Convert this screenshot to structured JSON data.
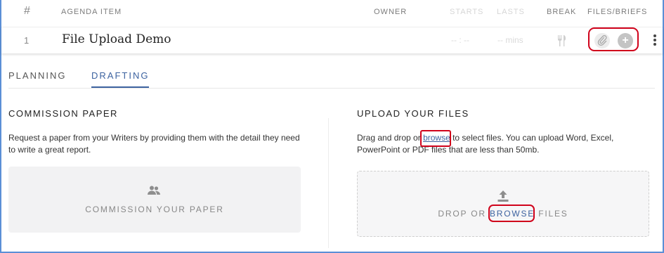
{
  "header": {
    "num": "#",
    "agenda_item": "AGENDA ITEM",
    "owner": "OWNER",
    "starts": "STARTS",
    "lasts": "LASTS",
    "break": "BREAK",
    "files_briefs": "FILES/BRIEFS"
  },
  "row": {
    "index": "1",
    "title": "File Upload Demo",
    "starts": "-- : --",
    "lasts": "-- mins"
  },
  "tabs": [
    {
      "label": "PLANNING",
      "active": false
    },
    {
      "label": "DRAFTING",
      "active": true
    }
  ],
  "commission": {
    "heading": "COMMISSION PAPER",
    "description": "Request a paper from your Writers by providing them with the detail they need to write a great report.",
    "button_label": "COMMISSION YOUR PAPER"
  },
  "upload": {
    "heading": "UPLOAD YOUR FILES",
    "text_before": "Drag and drop or ",
    "browse_link": "browse",
    "text_after": " to select files. You can upload Word, Excel, PowerPoint or PDF files that are less than 50mb.",
    "drop_before": "DROP OR ",
    "drop_browse": "BROWSE",
    "drop_after": " FILES"
  },
  "colors": {
    "accent": "#3d63a0",
    "highlight": "#d0021b",
    "frame": "#5b8fd6"
  }
}
